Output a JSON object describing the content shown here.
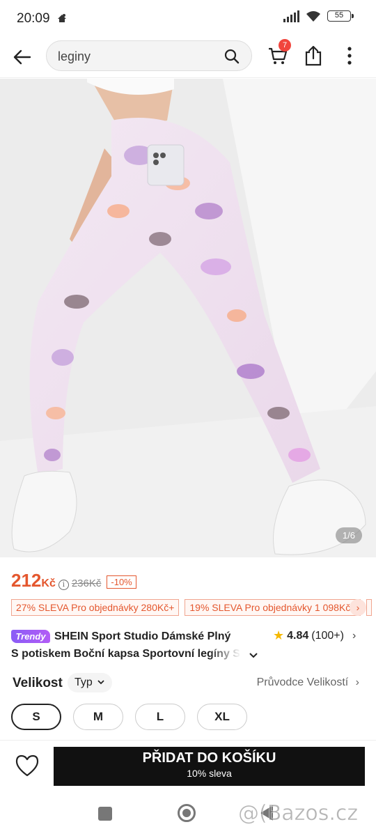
{
  "status_bar": {
    "time": "20:09",
    "battery": "55",
    "icons": [
      "notification-icon",
      "signal-icon",
      "wifi-icon",
      "battery-icon"
    ]
  },
  "header": {
    "search_value": "leginy",
    "cart_badge": "7",
    "icons": [
      "back-arrow-icon",
      "search-icon",
      "cart-icon",
      "share-icon",
      "more-icon"
    ]
  },
  "gallery": {
    "counter": "1/6",
    "current_index": 1,
    "total": 6
  },
  "price": {
    "current": "212",
    "currency": "Kč",
    "original": "236Kč",
    "discount": "-10%",
    "color": "#e4572e"
  },
  "coupons": [
    {
      "label": "27% SLEVA Pro objednávky 280Kč+"
    },
    {
      "label": "19% SLEVA Pro objednávky 1 098Kč+"
    }
  ],
  "product": {
    "badge": "Trendy",
    "title_line1": "SHEIN Sport Studio Dámské Plný",
    "title_line2": "S potiskem Boční kapsa Sportovní legíny S",
    "rating": "4.84",
    "review_count": "(100+)"
  },
  "size": {
    "label": "Velikost",
    "type_label": "Typ",
    "guide_label": "Průvodce Velikostí",
    "options": [
      "S",
      "M",
      "L",
      "XL"
    ],
    "selected": "S"
  },
  "action": {
    "add_to_cart": "PŘIDAT DO KOŠÍKU",
    "sub_label": "10% sleva"
  },
  "watermark": "@(Bazos.cz"
}
